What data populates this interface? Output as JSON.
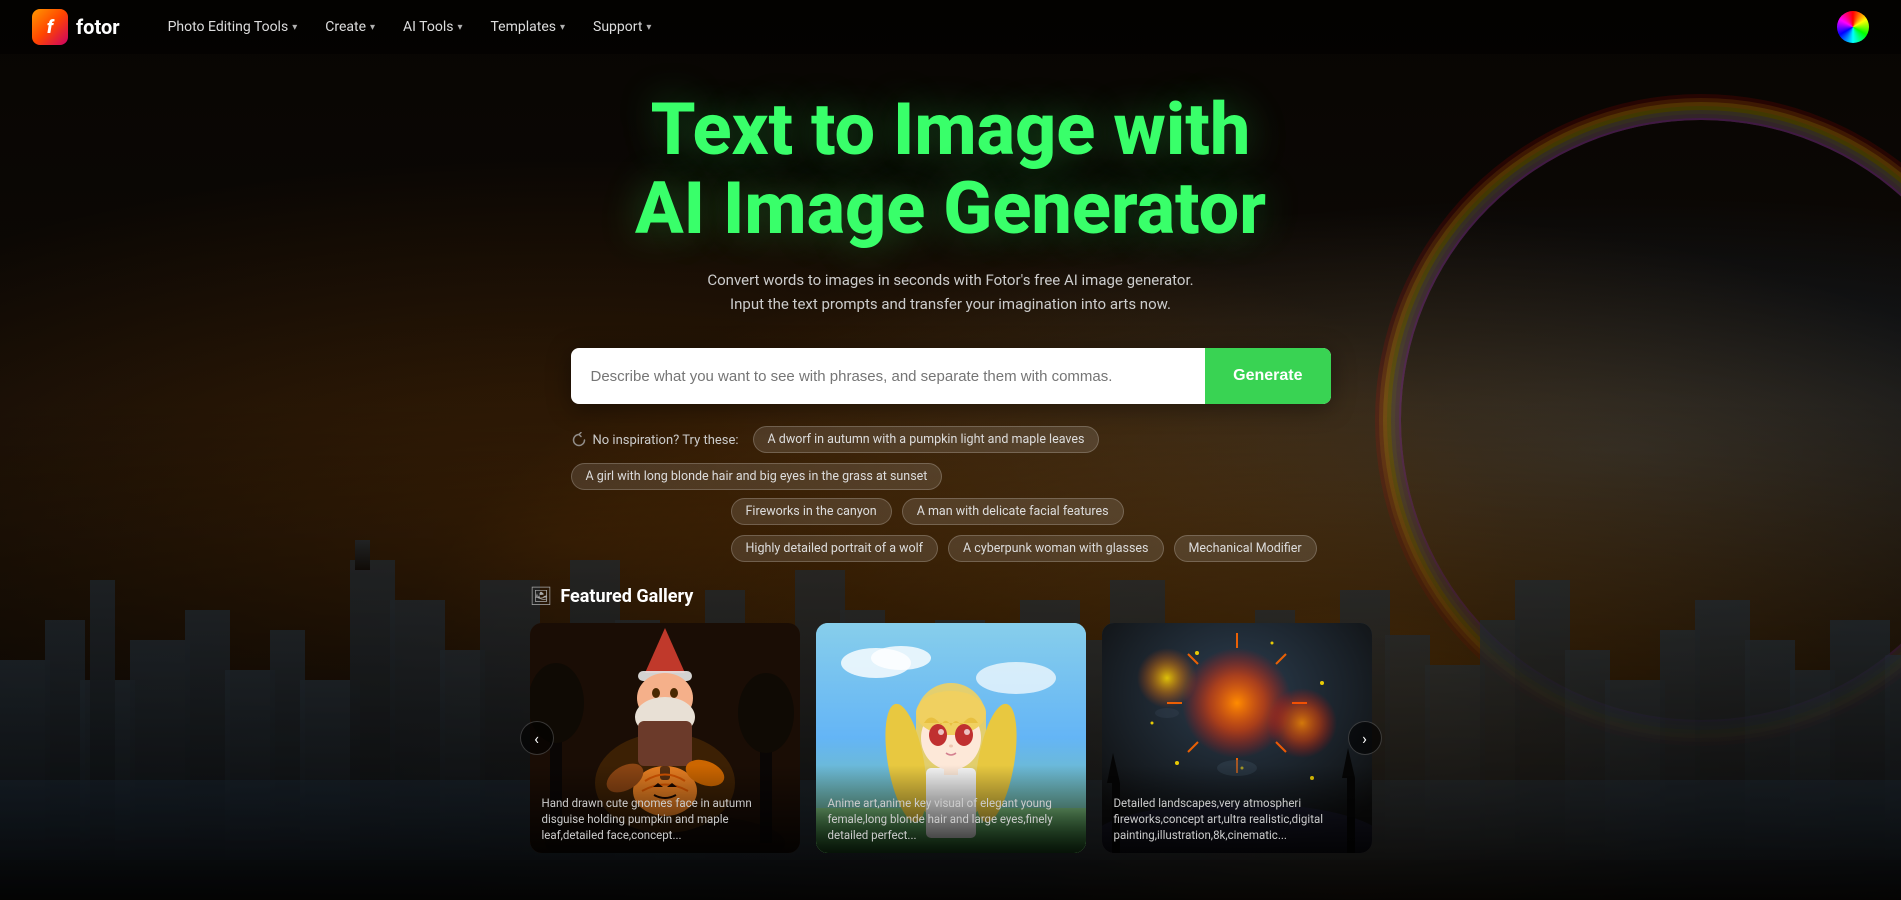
{
  "nav": {
    "logo_text": "fotor",
    "items": [
      {
        "label": "Photo Editing Tools",
        "has_chevron": true
      },
      {
        "label": "Create",
        "has_chevron": true
      },
      {
        "label": "AI Tools",
        "has_chevron": true
      },
      {
        "label": "Templates",
        "has_chevron": true
      },
      {
        "label": "Support",
        "has_chevron": true
      }
    ]
  },
  "hero": {
    "title_line1": "Text to Image with",
    "title_line2": "AI Image Generator",
    "subtitle": "Convert words to images in seconds with Fotor's free AI image generator. Input the text prompts and transfer your imagination into arts now.",
    "search_placeholder": "Describe what you want to see with phrases, and separate them with commas.",
    "generate_label": "Generate",
    "inspiration_label": "No inspiration? Try these:",
    "chips_row1": [
      "A dworf in autumn with a pumpkin light and maple leaves",
      "A girl with long blonde hair and big eyes in the grass at sunset"
    ],
    "chips_row2": [
      "Fireworks in the canyon",
      "A man with delicate facial features",
      "Highly detailed portrait of a wolf",
      "A cyberpunk woman with glasses",
      "Mechanical Modifier"
    ]
  },
  "gallery": {
    "section_title": "Featured Gallery",
    "cards": [
      {
        "caption": "Hand drawn cute gnomes face in autumn disguise holding pumpkin and maple leaf,detailed face,concept..."
      },
      {
        "caption": "Anime art,anime key visual of elegant young female,long blonde hair and large eyes,finely detailed perfect..."
      },
      {
        "caption": "Detailed landscapes,very atmospheri fireworks,concept art,ultra realistic,digital painting,illustration,8k,cinematic..."
      }
    ]
  }
}
